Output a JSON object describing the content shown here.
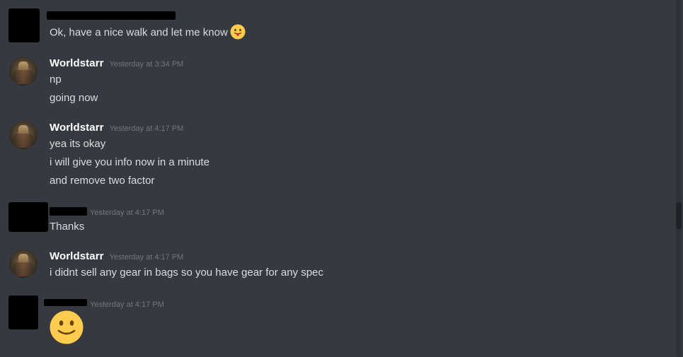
{
  "messages": [
    {
      "author": "",
      "author_redacted": true,
      "timestamp": "",
      "lines": [
        "Ok, have a nice walk and let me know"
      ],
      "trailing_emoji": "stuck-out-tongue-emoji"
    },
    {
      "author": "Worldstarr",
      "author_redacted": false,
      "timestamp": "Yesterday at 3:34 PM",
      "lines": [
        "np",
        "going now"
      ]
    },
    {
      "author": "Worldstarr",
      "author_redacted": false,
      "timestamp": "Yesterday at 4:17 PM",
      "lines": [
        "yea its okay",
        "i will give you info now in a minute",
        "and remove two factor"
      ]
    },
    {
      "author": "",
      "author_redacted": true,
      "timestamp": "Yesterday at 4:17 PM",
      "lines": [
        "Thanks"
      ]
    },
    {
      "author": "Worldstarr",
      "author_redacted": false,
      "timestamp": "Yesterday at 4:17 PM",
      "lines": [
        "i didnt sell any gear in bags so you have gear for any spec"
      ]
    },
    {
      "author": "",
      "author_redacted": true,
      "timestamp": "Yesterday at 4:17 PM",
      "lines": [],
      "emoji_only": "slightly-smiling-face-emoji"
    }
  ],
  "colors": {
    "background": "#36393f",
    "username": "#ffffff",
    "message_text": "#dcddde",
    "timestamp": "#72767d",
    "emoji_yellow": "#ffcc4d"
  }
}
